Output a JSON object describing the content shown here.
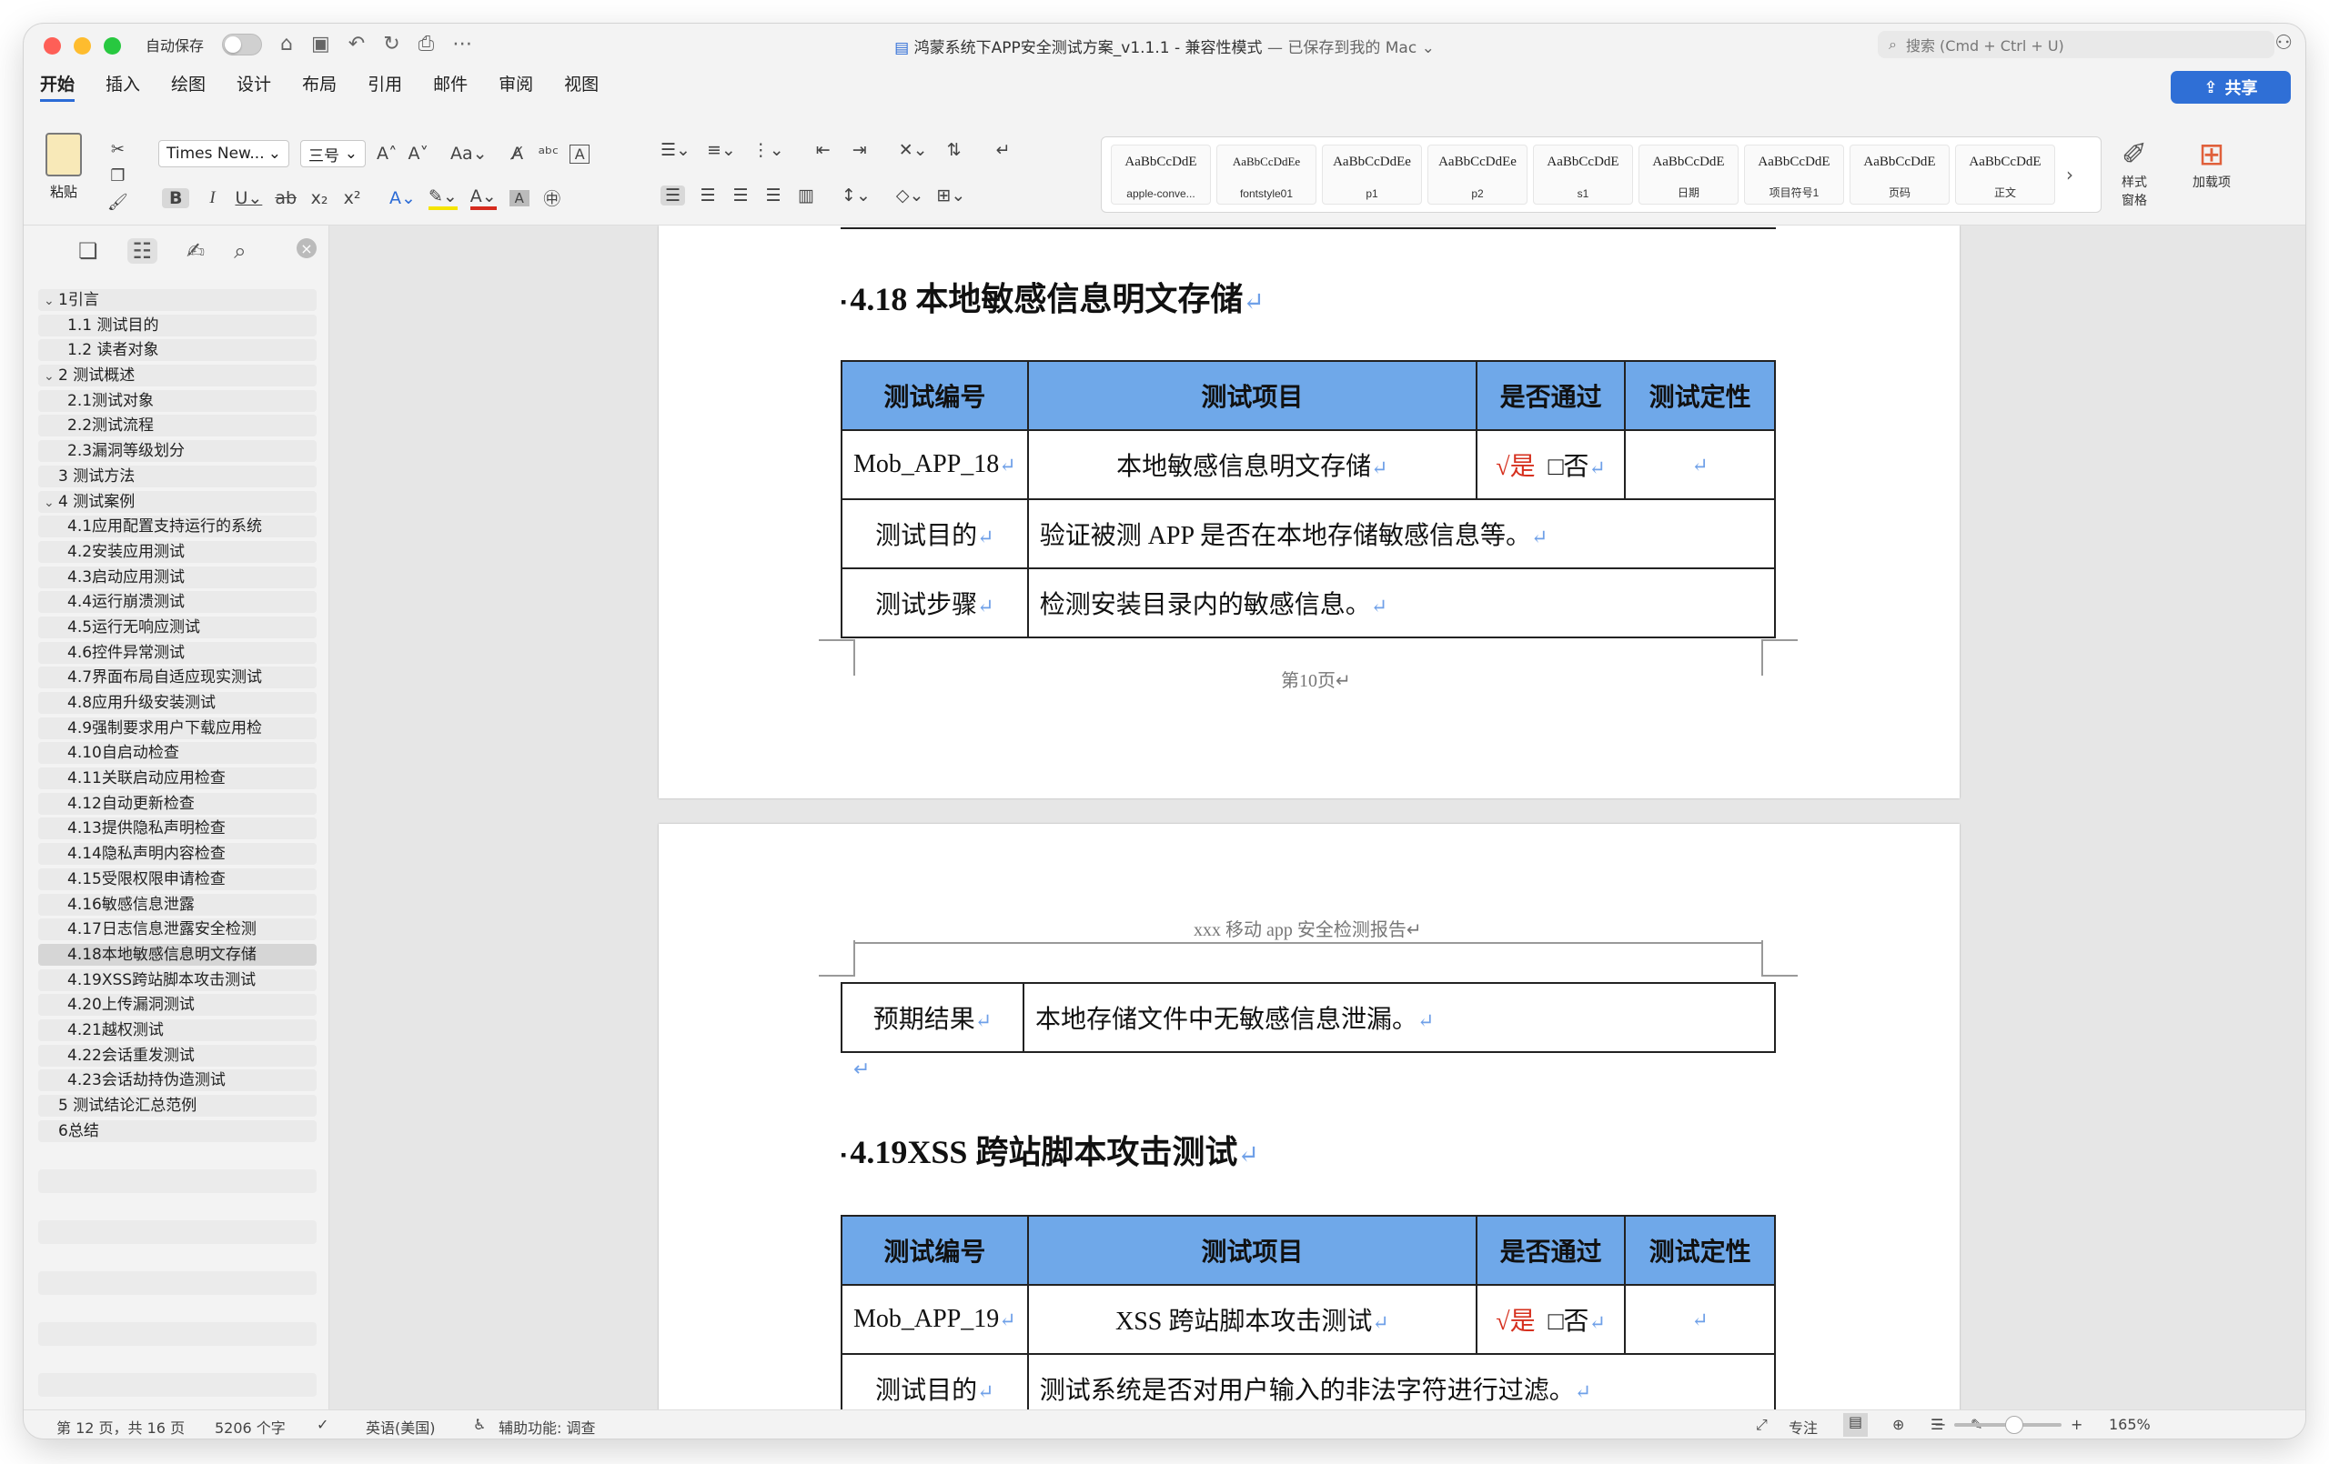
{
  "titlebar": {
    "autosave_label": "自动保存",
    "doc_name": "鸿蒙系统下APP安全测试方案_v1.1.1",
    "sep": " - ",
    "mode": "兼容性模式",
    "saved": "— 已保存到我的 Mac",
    "search_placeholder": "搜索 (Cmd + Ctrl + U)"
  },
  "tabs": [
    "开始",
    "插入",
    "绘图",
    "设计",
    "布局",
    "引用",
    "邮件",
    "审阅",
    "视图"
  ],
  "share_label": "共享",
  "ribbon": {
    "paste_label": "粘贴",
    "font_name": "Times New...",
    "font_size": "三号",
    "style_pane_label": "样式\n窗格",
    "addins_label": "加载项",
    "styles": [
      {
        "preview": "AaBbCcDdE",
        "name": "apple-conve..."
      },
      {
        "preview": "AaBbCcDdEe",
        "name": "fontstyle01"
      },
      {
        "preview": "AaBbCcDdEe",
        "name": "p1"
      },
      {
        "preview": "AaBbCcDdEe",
        "name": "p2"
      },
      {
        "preview": "AaBbCcDdE",
        "name": "s1"
      },
      {
        "preview": "AaBbCcDdE",
        "name": "日期"
      },
      {
        "preview": "AaBbCcDdE",
        "name": "项目符号1"
      },
      {
        "preview": "AaBbCcDdE",
        "name": "页码"
      },
      {
        "preview": "AaBbCcDdE",
        "name": "正文"
      }
    ]
  },
  "toc": [
    {
      "label": "1引言",
      "level": 1,
      "expand": true
    },
    {
      "label": "1.1 测试目的",
      "level": 2
    },
    {
      "label": "1.2 读者对象",
      "level": 2
    },
    {
      "label": "2 测试概述",
      "level": 1,
      "expand": true
    },
    {
      "label": "2.1测试对象",
      "level": 2
    },
    {
      "label": "2.2测试流程",
      "level": 2
    },
    {
      "label": "2.3漏洞等级划分",
      "level": 2
    },
    {
      "label": "3 测试方法",
      "level": 1
    },
    {
      "label": "4 测试案例",
      "level": 1,
      "expand": true
    },
    {
      "label": "4.1应用配置支持运行的系统",
      "level": 2
    },
    {
      "label": "4.2安装应用测试",
      "level": 2
    },
    {
      "label": "4.3启动应用测试",
      "level": 2
    },
    {
      "label": "4.4运行崩溃测试",
      "level": 2
    },
    {
      "label": "4.5运行无响应测试",
      "level": 2
    },
    {
      "label": "4.6控件异常测试",
      "level": 2
    },
    {
      "label": "4.7界面布局自适应现实测试",
      "level": 2
    },
    {
      "label": "4.8应用升级安装测试",
      "level": 2
    },
    {
      "label": "4.9强制要求用户下载应用检",
      "level": 2
    },
    {
      "label": "4.10自启动检查",
      "level": 2
    },
    {
      "label": "4.11关联启动应用检查",
      "level": 2
    },
    {
      "label": "4.12自动更新检查",
      "level": 2
    },
    {
      "label": "4.13提供隐私声明检查",
      "level": 2
    },
    {
      "label": "4.14隐私声明内容检查",
      "level": 2
    },
    {
      "label": "4.15受限权限申请检查",
      "level": 2
    },
    {
      "label": "4.16敏感信息泄露",
      "level": 2
    },
    {
      "label": "4.17日志信息泄露安全检测",
      "level": 2
    },
    {
      "label": "4.18本地敏感信息明文存储",
      "level": 2,
      "selected": true
    },
    {
      "label": "4.19XSS跨站脚本攻击测试",
      "level": 2
    },
    {
      "label": "4.20上传漏洞测试",
      "level": 2
    },
    {
      "label": "4.21越权测试",
      "level": 2
    },
    {
      "label": "4.22会话重发测试",
      "level": 2
    },
    {
      "label": "4.23会话劫持伪造测试",
      "level": 2
    },
    {
      "label": "5 测试结论汇总范例",
      "level": 1
    },
    {
      "label": "6总结",
      "level": 1
    }
  ],
  "doc": {
    "h418": "4.18 本地敏感信息明文存储",
    "h419": "4.19XSS 跨站脚本攻击测试",
    "col_id": "测试编号",
    "col_item": "测试项目",
    "col_pass": "是否通过",
    "col_type": "测试定性",
    "row_purpose": "测试目的",
    "row_steps": "测试步骤",
    "row_expect": "预期结果",
    "yes": "√是",
    "no": "□否",
    "t18_id": "Mob_APP_18",
    "t18_item": "本地敏感信息明文存储",
    "t18_purpose": "验证被测 APP 是否在本地存储敏感信息等。",
    "t18_steps": "检测安装目录内的敏感信息。",
    "t18_expect": "本地存储文件中无敏感信息泄漏。",
    "t19_id": "Mob_APP_19",
    "t19_item": "XSS 跨站脚本攻击测试",
    "t19_purpose": "测试系统是否对用户输入的非法字符进行过滤。",
    "footer": "第10页",
    "header": "xxx 移动 app 安全检测报告"
  },
  "status": {
    "page": "第 12 页，共 16 页",
    "words": "5206 个字",
    "lang": "英语(美国)",
    "a11y": "辅助功能: 调查",
    "focus": "专注",
    "zoom": "165%"
  }
}
